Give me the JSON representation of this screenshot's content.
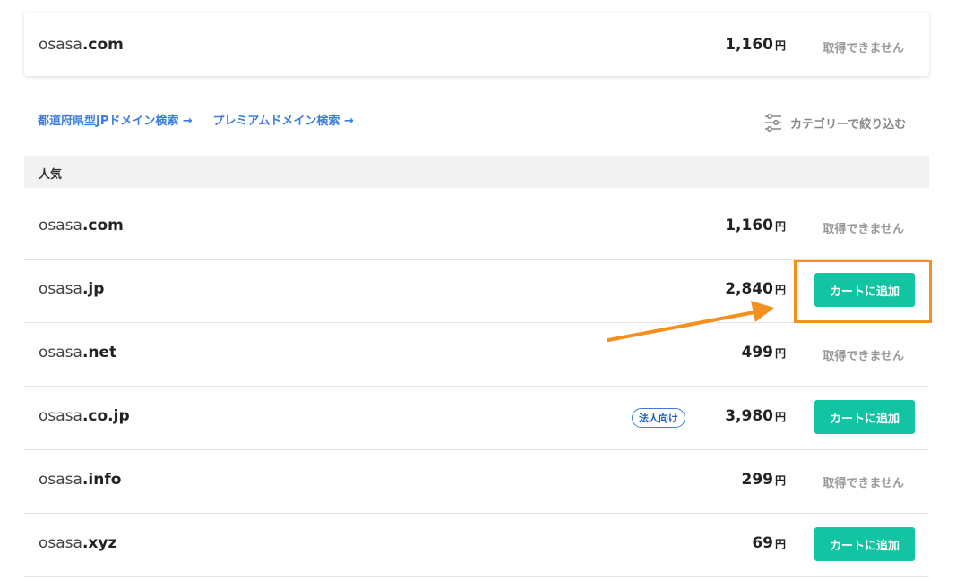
{
  "top_result": {
    "name": "osasa",
    "tld": ".com",
    "price": "1,160",
    "yen": "円",
    "status": "取得できません"
  },
  "links": {
    "prefecture": "都道府県型JPドメイン検索 →",
    "premium": "プレミアムドメイン検索 →"
  },
  "filter_label": "カテゴリーで絞り込む",
  "section_title": "人気",
  "rows": [
    {
      "name": "osasa",
      "tld": ".com",
      "price": "1,160",
      "yen": "円",
      "status": "取得できません"
    },
    {
      "name": "osasa",
      "tld": ".jp",
      "price": "2,840",
      "yen": "円",
      "action": "カートに追加"
    },
    {
      "name": "osasa",
      "tld": ".net",
      "price": "499",
      "yen": "円",
      "status": "取得できません"
    },
    {
      "name": "osasa",
      "tld": ".co.jp",
      "badge": "法人向け",
      "price": "3,980",
      "yen": "円",
      "action": "カートに追加"
    },
    {
      "name": "osasa",
      "tld": ".info",
      "price": "299",
      "yen": "円",
      "status": "取得できません"
    },
    {
      "name": "osasa",
      "tld": ".xyz",
      "price": "69",
      "yen": "円",
      "action": "カートに追加"
    }
  ],
  "colors": {
    "accent": "#13c4a3",
    "link": "#3b7de0",
    "highlight": "#f5901e"
  }
}
